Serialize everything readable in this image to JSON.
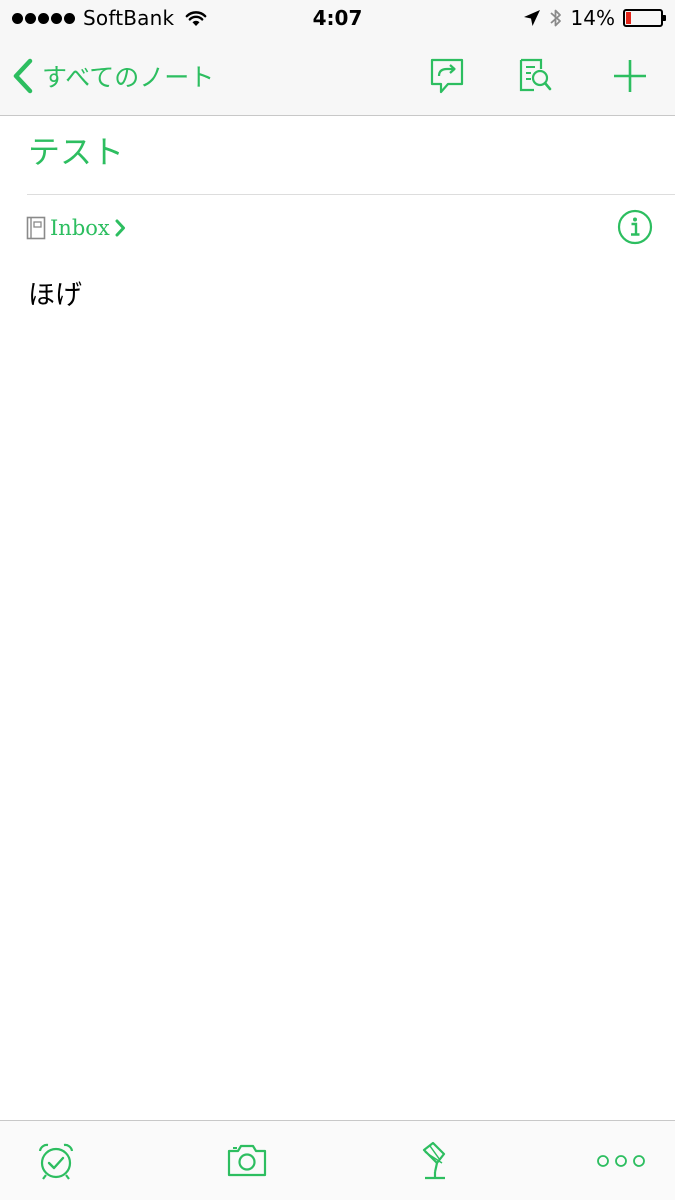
{
  "status_bar": {
    "carrier": "SoftBank",
    "time": "4:07",
    "battery_percent_label": "14%",
    "battery_level": 0.14,
    "battery_color": "#e3261b"
  },
  "nav": {
    "back_label": "すべてのノート",
    "actions": [
      "share-icon",
      "search-in-note-icon",
      "plus-icon"
    ]
  },
  "note": {
    "title": "テスト",
    "notebook": "Inbox",
    "body": "ほげ"
  },
  "toolbar": {
    "items": [
      "alarm-clock-icon",
      "camera-icon",
      "microphone-icon",
      "more-dots-icon"
    ]
  },
  "colors": {
    "accent": "#2dbe60",
    "bar_background": "#f7f7f7"
  }
}
